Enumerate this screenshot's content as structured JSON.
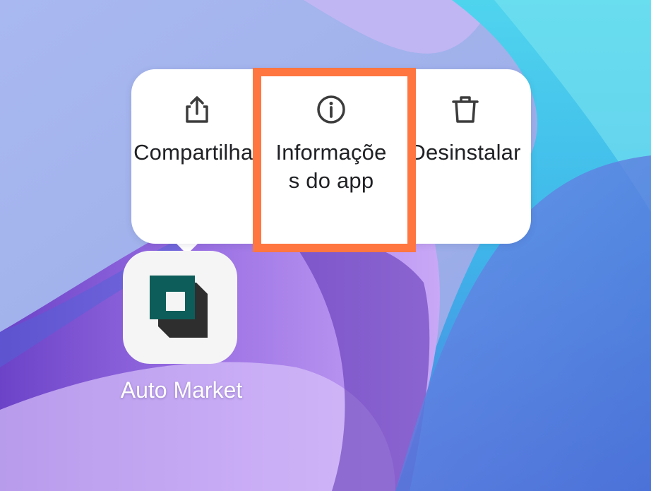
{
  "context_menu": {
    "items": [
      {
        "label": "Compartilhar",
        "icon": "share-icon"
      },
      {
        "label": "Informações do app",
        "icon": "info-icon"
      },
      {
        "label": "Desinstalar",
        "icon": "trash-icon"
      }
    ],
    "highlighted_item": "Informações do app"
  },
  "app": {
    "label": "Auto Market"
  },
  "colors": {
    "highlight": "#ff7640",
    "logo_teal": "#0d5e5a",
    "logo_dark": "#2e2e2e",
    "menu_text": "#202124"
  }
}
